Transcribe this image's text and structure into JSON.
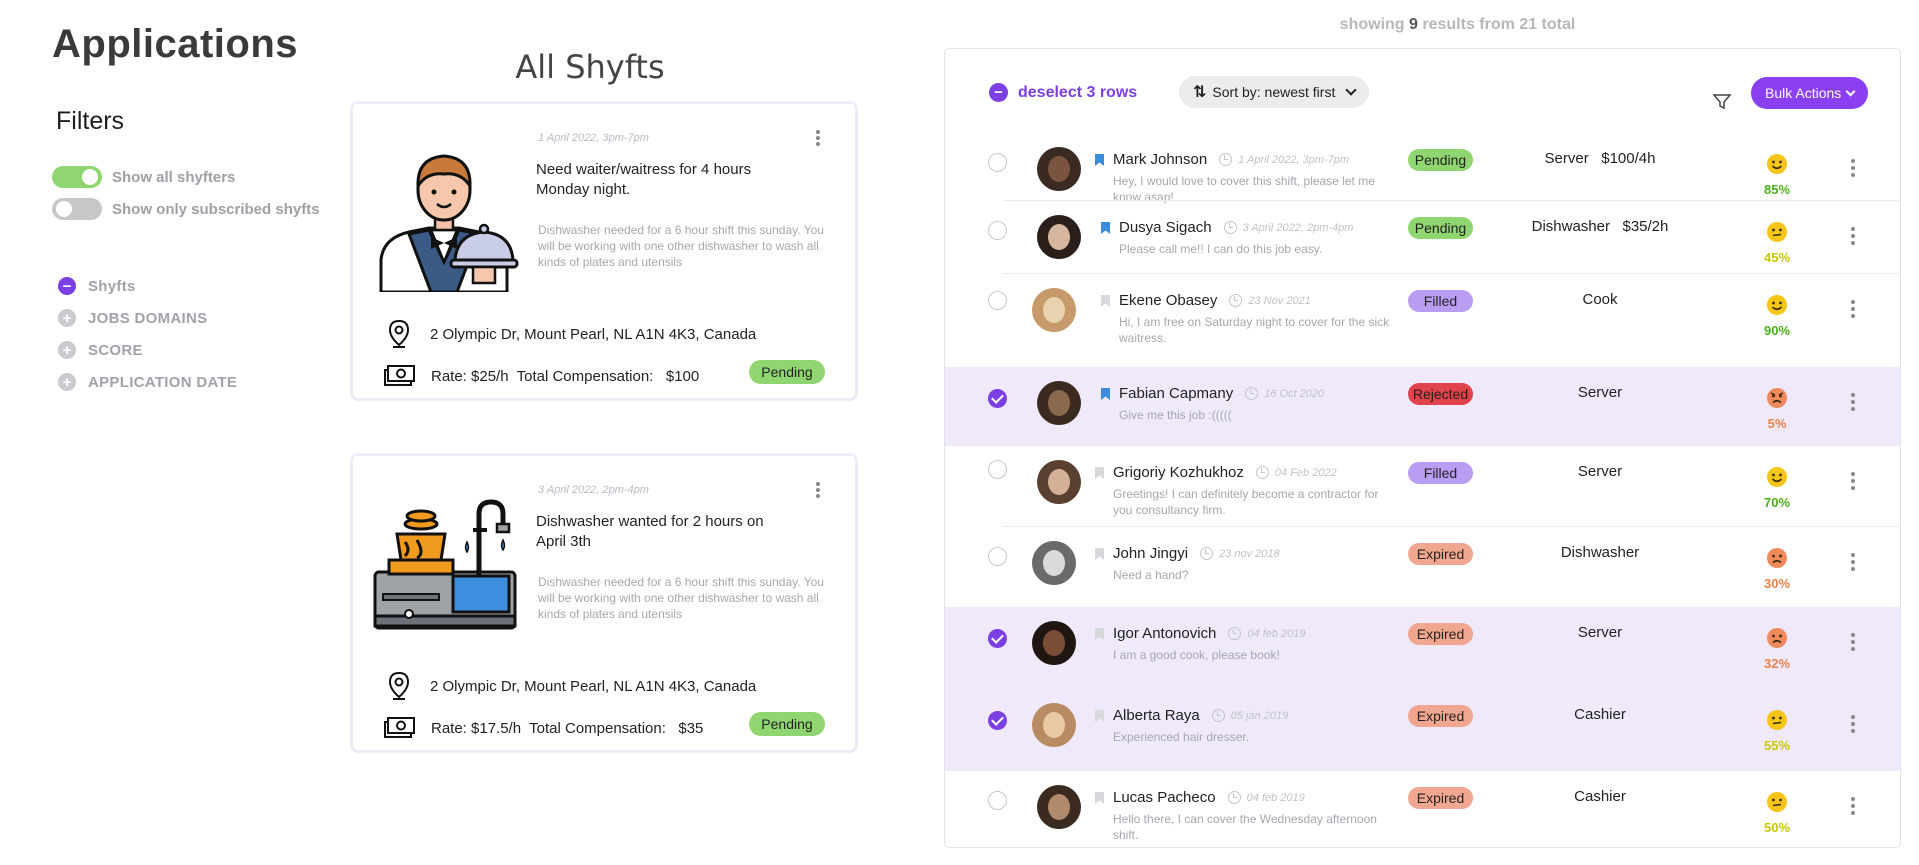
{
  "page": {
    "title": "Applications"
  },
  "filters": {
    "title": "Filters",
    "toggles": [
      {
        "label": "Show all shyfters",
        "on": true
      },
      {
        "label": "Show only subscribed shyfts",
        "on": false
      }
    ],
    "nav": [
      {
        "label": "Shyfts",
        "icon": "minus-circle-icon",
        "expanded": true
      },
      {
        "label": "JOBS DOMAINS",
        "icon": "plus-circle-icon",
        "expanded": false
      },
      {
        "label": "SCORE",
        "icon": "plus-circle-icon",
        "expanded": false
      },
      {
        "label": "APPLICATION DATE",
        "icon": "plus-circle-icon",
        "expanded": false
      }
    ]
  },
  "shyfts": {
    "heading": "All Shyfts",
    "cards": [
      {
        "illustration": "waiter-illustration",
        "date": "1 April 2022, 3pm-7pm",
        "title": "Need waiter/waitress for 4 hours Monday night.",
        "description": "Dishwasher needed for a 6 hour shift this sunday. You will be working with one other dishwasher to wash all kinds of plates and utensils",
        "address": "2 Olympic Dr, Mount Pearl, NL A1N 4K3, Canada",
        "rate_text": "Rate: $25/h  Total Compensation:   $100",
        "status": "Pending"
      },
      {
        "illustration": "dishwasher-sink-illustration",
        "date": "3 April 2022, 2pm-4pm",
        "title": "Dishwasher wanted for 2 hours on April 3th",
        "description": "Dishwasher needed for a 6 hour shift this sunday. You will be working with one other dishwasher to wash all kinds of plates and utensils",
        "address": "2 Olympic Dr, Mount Pearl, NL A1N 4K3, Canada",
        "rate_text": "Rate: $17.5/h  Total Compensation:   $35",
        "status": "Pending"
      }
    ]
  },
  "results": {
    "prefix": "showing",
    "count": "9",
    "suffix": "results from 21 total"
  },
  "toolbar": {
    "deselect_label": "deselect 3 rows",
    "sort_label": "Sort by: newest first",
    "bulk_label": "Bulk Actions"
  },
  "applicants": [
    {
      "name": "Mark Johnson",
      "date": "1 April 2022, 3pm-7pm",
      "message": "Hey, I would love to cover this shift, please let me know asap!",
      "status": "Pending",
      "role": "Server   $100/4h",
      "score": "85%",
      "mood": "happy",
      "selected": false,
      "bookmarked": true
    },
    {
      "name": "Dusya Sigach",
      "date": "3 April 2022, 2pm-4pm",
      "message": "Please call me!! I can do this job easy.",
      "status": "Pending",
      "role": "Dishwasher   $35/2h",
      "score": "45%",
      "mood": "neutral",
      "selected": false,
      "bookmarked": true
    },
    {
      "name": "Ekene Obasey",
      "date": "23 Nov 2021",
      "message": "Hi, I am free on Saturday night to cover for the sick waitress.",
      "status": "Filled",
      "role": "Cook",
      "score": "90%",
      "mood": "happy",
      "selected": false,
      "bookmarked": false
    },
    {
      "name": "Fabian Capmany",
      "date": "16 Oct 2020",
      "message": "Give me this job :(((((",
      "status": "Rejected",
      "role": "Server",
      "score": "5%",
      "mood": "angry",
      "selected": true,
      "bookmarked": true
    },
    {
      "name": "Grigoriy Kozhukhoz",
      "date": "04 Feb 2022",
      "message": "Greetings! I can definitely become a contractor for you consultancy firm.",
      "status": "Filled",
      "role": "Server",
      "score": "70%",
      "mood": "happy",
      "selected": false,
      "bookmarked": false
    },
    {
      "name": "John Jingyi",
      "date": "23 nov 2018",
      "message": "Need a hand?",
      "status": "Expired",
      "role": "Dishwasher",
      "score": "30%",
      "mood": "sad",
      "selected": false,
      "bookmarked": false
    },
    {
      "name": "Igor Antonovich",
      "date": "04 feb 2019",
      "message": "I am a good cook, please book!",
      "status": "Expired",
      "role": "Server",
      "score": "32%",
      "mood": "sad",
      "selected": true,
      "bookmarked": false
    },
    {
      "name": "Alberta Raya",
      "date": "05 jan 2019",
      "message": "Experienced hair dresser.",
      "status": "Expired",
      "role": "Cashier",
      "score": "55%",
      "mood": "neutral",
      "selected": true,
      "bookmarked": false
    },
    {
      "name": "Lucas Pacheco",
      "date": "04 feb 2019",
      "message": "Hello there, I can cover the Wednesday afternoon shift.",
      "status": "Expired",
      "role": "Cashier",
      "score": "50%",
      "mood": "neutral",
      "selected": false,
      "bookmarked": false
    }
  ],
  "colors": {
    "accent": "#7b3fe4",
    "pending": "#8fd670",
    "filled": "#b99df2",
    "rejected": "#e0434b",
    "expired": "#f0a68f",
    "selected_row": "#efe9fb",
    "score_green": "#4caf1a",
    "score_yellow": "#c9c800",
    "score_orange": "#e8834a"
  }
}
